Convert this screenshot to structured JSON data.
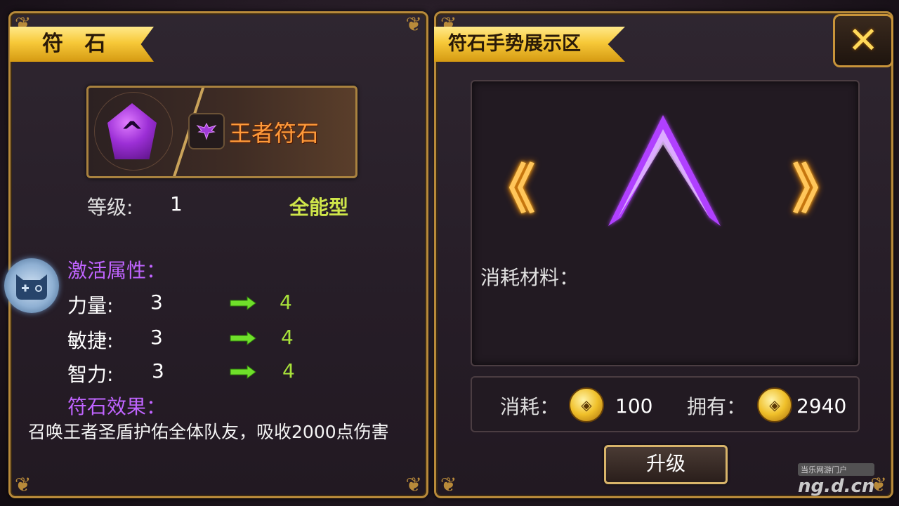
{
  "left_panel": {
    "title": "符 石",
    "rune_name": "王者符石",
    "gem_glyph": "^",
    "level_label": "等级:",
    "level_value": "1",
    "type_label": "全能型",
    "attr_heading": "激活属性：",
    "attributes": [
      {
        "label": "力量:",
        "from": "3",
        "to": "4"
      },
      {
        "label": "敏捷:",
        "from": "3",
        "to": "4"
      },
      {
        "label": "智力:",
        "from": "3",
        "to": "4"
      }
    ],
    "effect_heading": "符石效果：",
    "effect_text": "召唤王者圣盾护佑全体队友，吸收2000点伤害"
  },
  "right_panel": {
    "title": "符石手势展示区",
    "prev_glyph": "《",
    "next_glyph": "》",
    "material_label": "消耗材料：",
    "cost_label": "消耗：",
    "cost_value": "100",
    "owned_label": "拥有：",
    "owned_value": "2940",
    "upgrade_label": "升级",
    "close_glyph": "✕"
  },
  "watermark": {
    "small": "当乐网游门户",
    "big": "ng.d.cn"
  },
  "colors": {
    "frame_gold": "#b88a3a",
    "ribbon_gold": "#f7c939",
    "attr_purple": "#c064ff",
    "value_green": "#a8e23a",
    "rune_name_orange": "#ff9a3a",
    "gesture_purple": "#b040ff"
  },
  "icons": {
    "gem": "purple-rune-gem-icon",
    "emblem": "eagle-emblem-icon",
    "arrow": "green-right-arrow-icon",
    "coin": "gold-coin-icon",
    "controller": "gamepad-cat-icon"
  }
}
